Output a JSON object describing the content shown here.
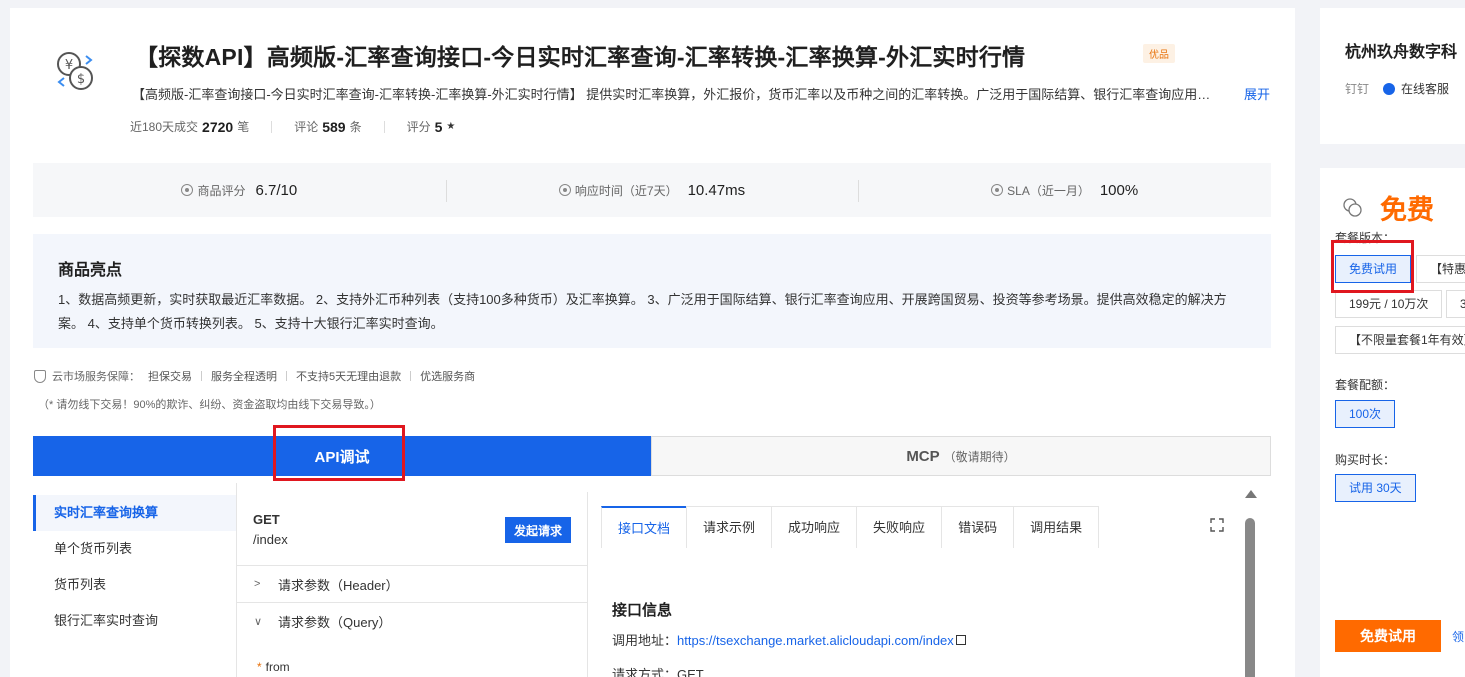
{
  "product": {
    "title": "【探数API】高频版-汇率查询接口-今日实时汇率查询-汇率转换-汇率换算-外汇实时行情",
    "badge": "优品",
    "description": "【高频版-汇率查询接口-今日实时汇率查询-汇率转换-汇率换算-外汇实时行情】 提供实时汇率换算，外汇报价，货币汇率以及币种之间的汇率转换。广泛用于国际结算、银行汇率查询应用、开展跨国贸易、投资等参考场景。",
    "expand": "展开",
    "stats": {
      "sales_label": "近180天成交",
      "sales_value": "2720",
      "sales_unit": "笔",
      "reviews_label": "评论",
      "reviews_value": "589",
      "reviews_unit": "条",
      "rating_label": "评分",
      "rating_value": "5",
      "rating_star": "★"
    }
  },
  "metrics": [
    {
      "icon": "rating-icon",
      "label": "商品评分",
      "value": "6.7/10"
    },
    {
      "icon": "clock-icon",
      "label": "响应时间（近7天）",
      "value": "10.47ms"
    },
    {
      "icon": "check-circle-icon",
      "label": "SLA（近一月）",
      "value": "100%"
    }
  ],
  "highlights": {
    "title": "商品亮点",
    "text": "1、数据高频更新，实时获取最近汇率数据。 2、支持外汇币种列表（支持100多种货币）及汇率换算。 3、广泛用于国际结算、银行汇率查询应用、开展跨国贸易、投资等参考场景。提供高效稳定的解决方案。 4、支持单个货币转换列表。 5、支持十大银行汇率实时查询。"
  },
  "guarantee": {
    "label": "云市场服务保障：",
    "items": [
      "担保交易",
      "服务全程透明",
      "不支持5天无理由退款",
      "优选服务商"
    ],
    "note": "（* 请勿线下交易！90%的欺诈、纠纷、资金盗取均由线下交易导致。）"
  },
  "big_tabs": {
    "api": "API调试",
    "mcp": "MCP",
    "mcp_sub": "（敬请期待）"
  },
  "api_list": [
    "实时汇率查询换算",
    "单个货币列表",
    "货币列表",
    "银行汇率实时查询"
  ],
  "request": {
    "method": "GET",
    "path": "/index",
    "send": "发起请求",
    "header_params": "请求参数（Header）",
    "query_params": "请求参数（Query）",
    "required_mark": "*",
    "field": "from"
  },
  "doc_tabs": [
    "接口文档",
    "请求示例",
    "成功响应",
    "失败响应",
    "错误码",
    "调用结果"
  ],
  "doc": {
    "heading": "接口信息",
    "url_label": "调用地址：",
    "url": "https://tsexchange.market.alicloudapi.com/index",
    "method_label": "请求方式：",
    "method": "GET"
  },
  "vendor": {
    "name": "杭州玖舟数字科",
    "dingtalk": "钉钉",
    "cs": "在线客服"
  },
  "purchase": {
    "price": "免费",
    "version_label": "套餐版本：",
    "versions": [
      "免费试用",
      "【特惠",
      "199元 / 10万次",
      "3",
      "【不限量套餐1年有效】"
    ],
    "quota_label": "套餐配额：",
    "quota": "100次",
    "duration_label": "购买时长：",
    "duration": "试用 30天",
    "buy": "免费试用",
    "coupon": "领"
  }
}
